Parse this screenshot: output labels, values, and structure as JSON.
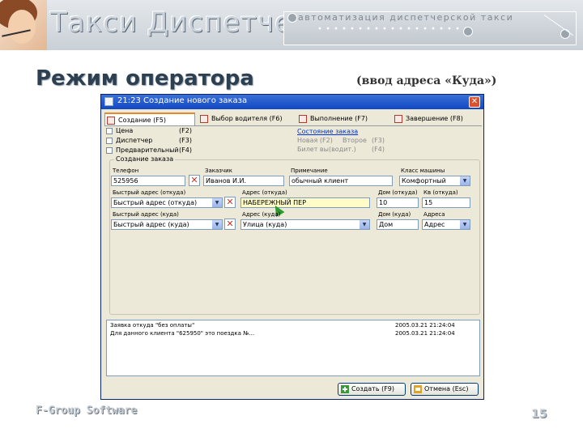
{
  "slide": {
    "logo_title": "Такси Диспетчер",
    "tagline": "автоматизация диспетчерской такси",
    "title": "Режим оператора",
    "note": "(ввод адреса «Куда»)",
    "footer": "F-Group Software",
    "page_number": "15"
  },
  "window": {
    "title": "21:23 Создание нового заказа",
    "close_symbol": "✕"
  },
  "tabs": [
    {
      "label": "Создание (F5)",
      "active": true
    },
    {
      "label": "Выбор водителя (F6)",
      "active": false
    },
    {
      "label": "Выполнение (F7)",
      "active": false
    },
    {
      "label": "Завершение (F8)",
      "active": false
    }
  ],
  "steps": [
    {
      "label": "Цена",
      "key": "(F2)"
    },
    {
      "label": "Диспетчер",
      "key": "(F3)"
    },
    {
      "label": "Предварительный",
      "key": "(F4)"
    }
  ],
  "status": {
    "link": "Состояние заказа",
    "row1_a": "Новая  (F2)",
    "row1_b": "Второе",
    "row1_c": "(F3)",
    "row2_a": "Билет вы(водит.)",
    "row2_b": "(F4)"
  },
  "form": {
    "group_label": "Создание заказа",
    "phone_label": "Телефон",
    "phone_value": "525956",
    "customer_label": "Заказчик",
    "customer_value": "Иванов И.И.",
    "note_label": "Примечание",
    "note_value": "обычный клиент",
    "car_class_label": "Класс машины",
    "car_class_value": "Комфортный",
    "quick_from_label": "Быстрый адрес (откуда)",
    "quick_from_value": "Быстрый адрес (откуда)",
    "addr_from_label": "Адрес (откуда)",
    "addr_from_value": "НАБЕРЕЖНЫЙ ПЕР",
    "house_from_label": "Дом (откуда)",
    "house_from_value": "10",
    "apt_from_label": "Кв (откуда)",
    "apt_from_value": "15",
    "quick_to_label": "Быстрый адрес (куда)",
    "quick_to_value": "Быстрый адрес (куда)",
    "addr_to_label": "Адрес (куда)",
    "addr_to_value": "Улица (куда)",
    "house_to_label": "Дом (куда)",
    "house_to_value": "Дом",
    "dest_label": "Адреса",
    "dest_value": "Адрес"
  },
  "log": [
    {
      "text": "Заявка откуда \"без оплаты\"",
      "time": "2005.03.21 21:24:04"
    },
    {
      "text": "Для данного клиента \"625950\" это поездка №...",
      "time": "2005.03.21 21:24:04"
    }
  ],
  "buttons": {
    "create": "Создать (F9)",
    "cancel": "Отмена (Esc)"
  },
  "colors": {
    "title_bar": "#1148c4",
    "active_tab_accent": "#e68b2c",
    "highlight_field": "#fffcc8",
    "link": "#0033cc"
  }
}
